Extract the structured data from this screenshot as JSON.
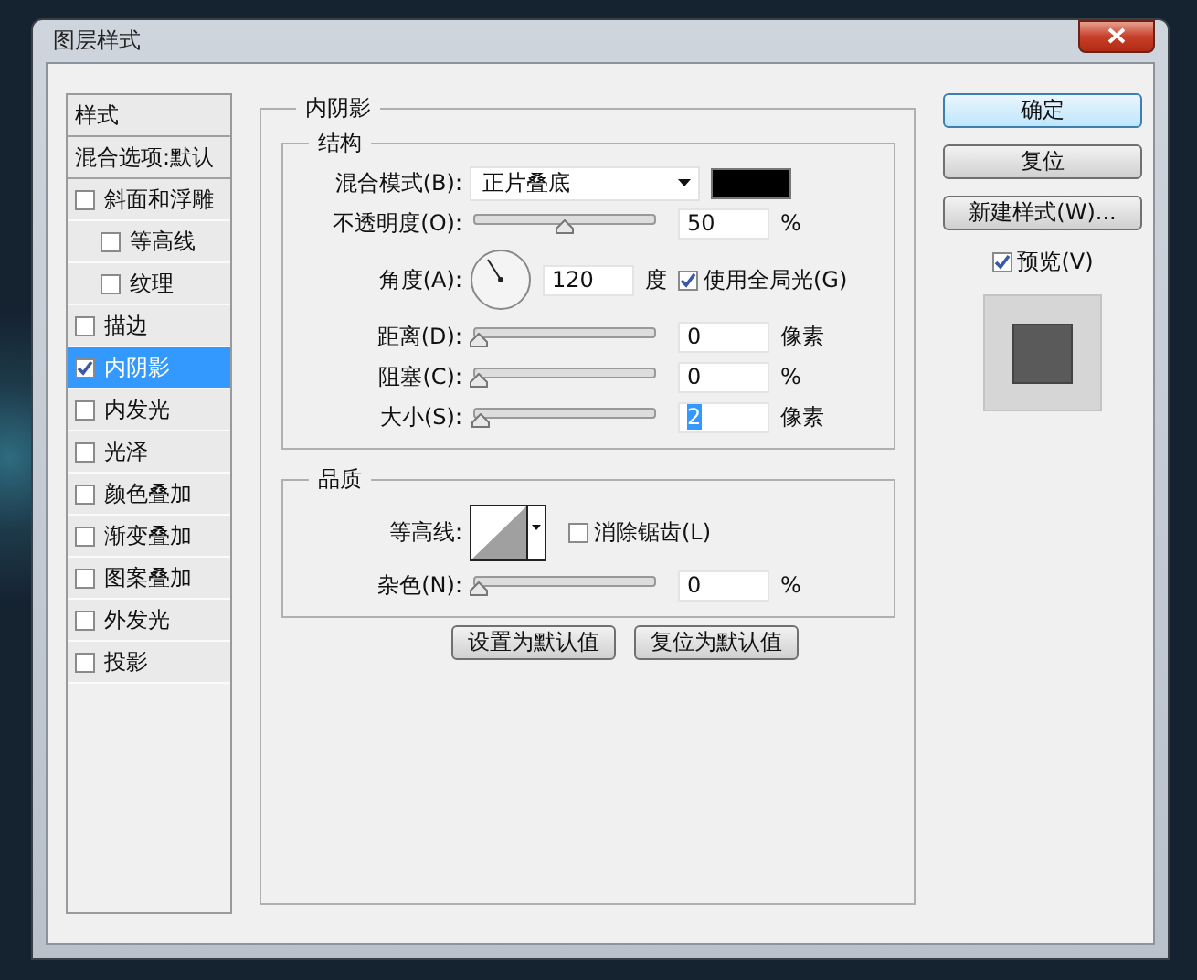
{
  "window": {
    "title": "图层样式"
  },
  "sidebar": {
    "header": "样式",
    "items": [
      {
        "kind": "plain",
        "label": "混合选项:默认",
        "selected": false
      },
      {
        "kind": "check",
        "label": "斜面和浮雕",
        "checked": false,
        "selected": false,
        "children": [
          {
            "kind": "check",
            "label": "等高线",
            "checked": false,
            "selected": false
          },
          {
            "kind": "check",
            "label": "纹理",
            "checked": false,
            "selected": false
          }
        ]
      },
      {
        "kind": "check",
        "label": "描边",
        "checked": false,
        "selected": false
      },
      {
        "kind": "check",
        "label": "内阴影",
        "checked": true,
        "selected": true
      },
      {
        "kind": "check",
        "label": "内发光",
        "checked": false,
        "selected": false
      },
      {
        "kind": "check",
        "label": "光泽",
        "checked": false,
        "selected": false
      },
      {
        "kind": "check",
        "label": "颜色叠加",
        "checked": false,
        "selected": false
      },
      {
        "kind": "check",
        "label": "渐变叠加",
        "checked": false,
        "selected": false
      },
      {
        "kind": "check",
        "label": "图案叠加",
        "checked": false,
        "selected": false
      },
      {
        "kind": "check",
        "label": "外发光",
        "checked": false,
        "selected": false
      },
      {
        "kind": "check",
        "label": "投影",
        "checked": false,
        "selected": false
      }
    ]
  },
  "panel": {
    "title": "内阴影",
    "structure": {
      "title": "结构",
      "rows": [
        {
          "kind": "blend",
          "label": "混合模式(B):",
          "value": "正片叠底",
          "color": "#000000"
        },
        {
          "kind": "slider",
          "label": "不透明度(O):",
          "level": 0.5,
          "value": "50",
          "unit": "%",
          "selected": false
        },
        {
          "kind": "angle",
          "label": "角度(A):",
          "value": "120",
          "unit": "度",
          "global_light": {
            "label": "使用全局光(G)",
            "checked": true
          }
        },
        {
          "kind": "slider",
          "label": "距离(D):",
          "level": 0,
          "value": "0",
          "unit": "像素",
          "selected": false
        },
        {
          "kind": "slider",
          "label": "阻塞(C):",
          "level": 0,
          "value": "0",
          "unit": "%",
          "selected": false
        },
        {
          "kind": "slider",
          "label": "大小(S):",
          "level": 0.01,
          "value": "2",
          "unit": "像素",
          "selected": true
        }
      ]
    },
    "quality": {
      "title": "品质",
      "rows": [
        {
          "kind": "contour",
          "label": "等高线:",
          "antialias": {
            "label": "消除锯齿(L)",
            "checked": false
          }
        },
        {
          "kind": "slider",
          "label": "杂色(N):",
          "level": 0,
          "value": "0",
          "unit": "%",
          "selected": false
        }
      ]
    },
    "buttons": [
      "设置为默认值",
      "复位为默认值"
    ]
  },
  "actions": [
    {
      "label": "确定",
      "default": true
    },
    {
      "label": "复位",
      "default": false
    },
    {
      "label": "新建样式(W)...",
      "default": false
    }
  ],
  "preview": {
    "label": "预览(V)",
    "checked": true
  }
}
